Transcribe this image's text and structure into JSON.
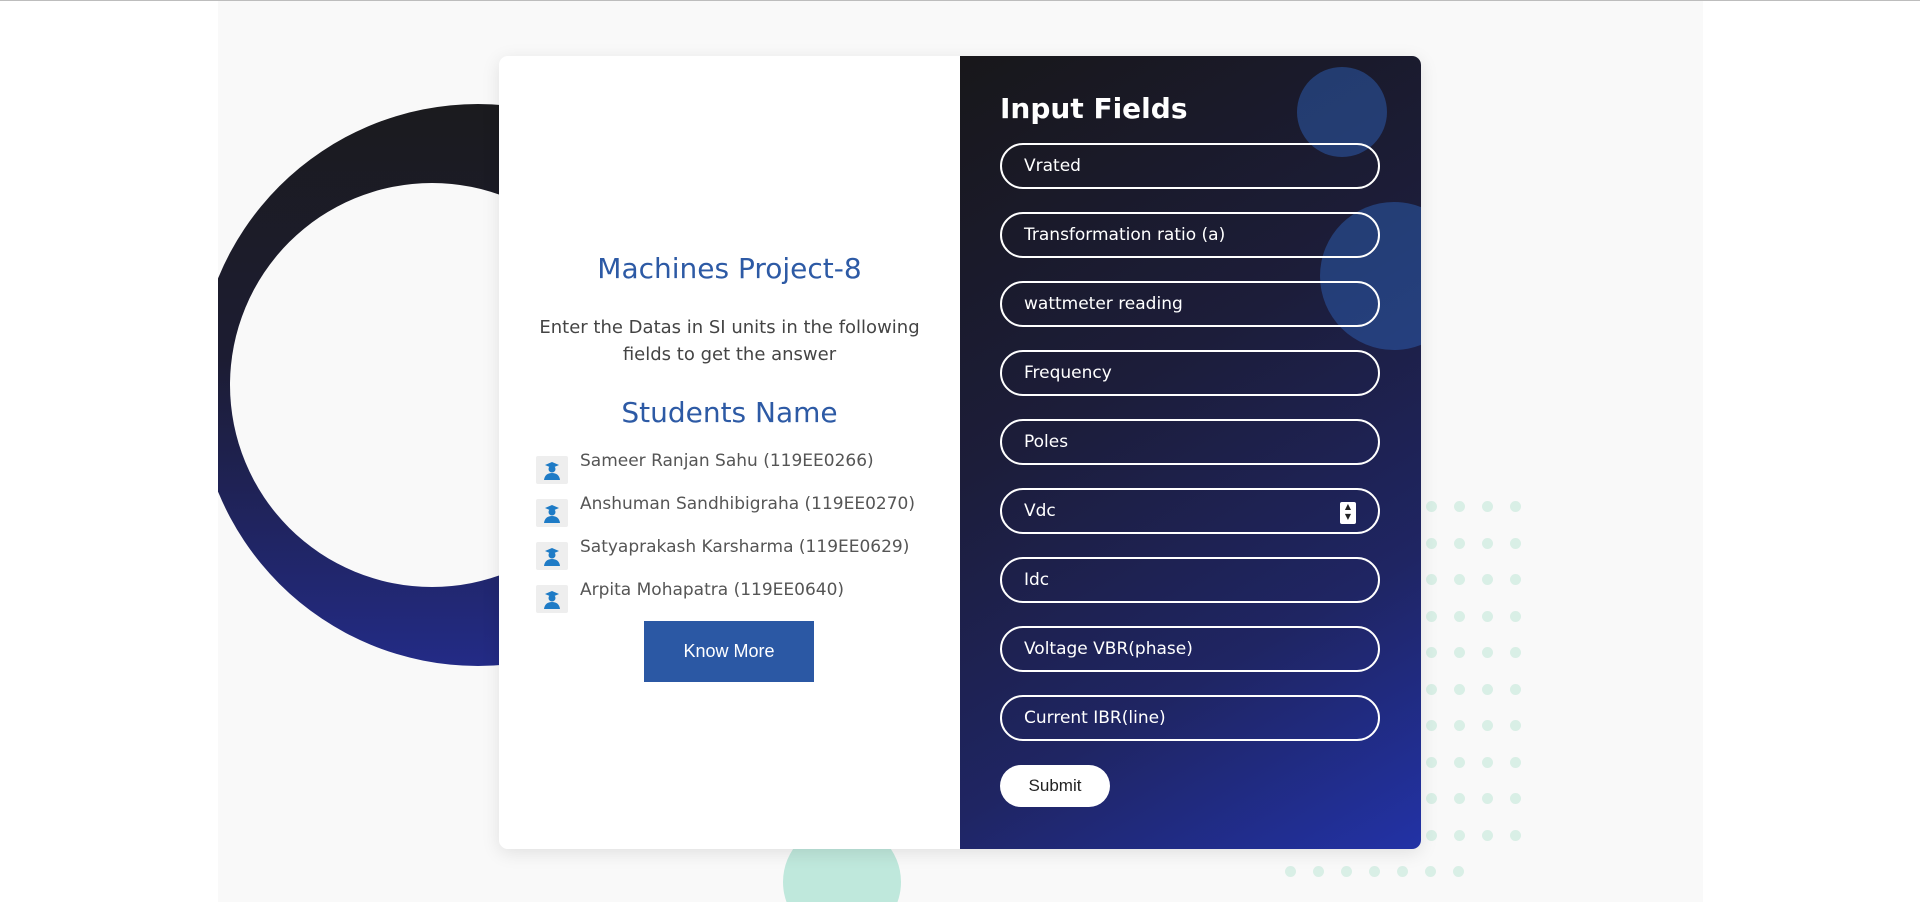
{
  "left_panel": {
    "title": "Machines Project-8",
    "description": "Enter the Datas in SI units in the following fields to get the answer",
    "students_heading": "Students Name",
    "students": [
      "Sameer Ranjan Sahu (119EE0266)",
      "Anshuman Sandhibigraha (119EE0270)",
      "Satyaprakash Karsharma (119EE0629)",
      "Arpita Mohapatra (119EE0640)"
    ],
    "know_more_label": "Know More"
  },
  "form": {
    "title": "Input Fields",
    "fields": [
      {
        "placeholder": "Vrated"
      },
      {
        "placeholder": "Transformation ratio (a)"
      },
      {
        "placeholder": "wattmeter reading"
      },
      {
        "placeholder": "Frequency"
      },
      {
        "placeholder": "Poles"
      },
      {
        "placeholder": "Vdc"
      },
      {
        "placeholder": "Idc"
      },
      {
        "placeholder": "Voltage VBR(phase)"
      },
      {
        "placeholder": "Current IBR(line)"
      }
    ],
    "submit_label": "Submit"
  },
  "colors": {
    "accent_blue": "#2b58a4",
    "panel_gradient_start": "#18171a",
    "panel_gradient_end": "#2232a6",
    "dot_color": "#d9efe6"
  },
  "icons": {
    "student": "user-graduate-icon",
    "stepper": "spinner-arrows-icon"
  }
}
